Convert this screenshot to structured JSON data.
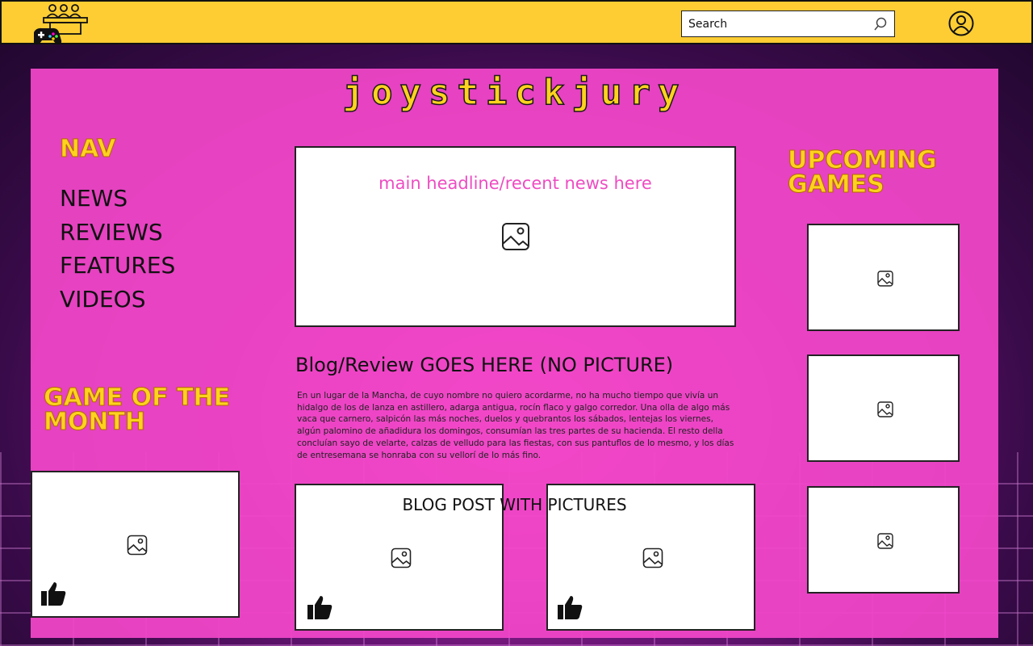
{
  "site": {
    "title": "JoystickJury"
  },
  "header": {
    "search_placeholder": "Search",
    "icons": [
      "jury-gamepad-logo",
      "search-icon",
      "user-icon"
    ]
  },
  "nav": {
    "heading": "NAV",
    "items": [
      {
        "label": "NEWS"
      },
      {
        "label": "REVIEWS"
      },
      {
        "label": "FEATURES"
      },
      {
        "label": "VIDEOS"
      }
    ]
  },
  "main": {
    "headline_placeholder": "main headline/recent news here",
    "blog_title": "Blog/Review GOES HERE (NO PICTURE)",
    "blog_body": "En un lugar de la Mancha, de cuyo nombre no quiero acordarme, no ha mucho tiempo que vivía un hidalgo de los de lanza en astillero, adarga antigua, rocín flaco y galgo corredor. Una olla de algo más vaca que carnero, salpicón las más noches, duelos y quebrantos los sábados, lentejas los viernes, algún palomino de añadidura los domingos, consumían las tres partes de su hacienda. El resto della concluían sayo de velarte, calzas de velludo para las fiestas, con sus pantuflos de lo mesmo, y los días de entresemana se honraba con su vellorí de lo más fino.",
    "posts_label": "BLOG POST WITH PICTURES"
  },
  "game_of_the_month": {
    "heading": "GAME OF THE MONTH"
  },
  "upcoming": {
    "heading": "UPCOMING GAMES"
  },
  "colors": {
    "topbar": "#fecd33",
    "panel": "#f046c8",
    "title_yellow": "#ffd21f",
    "headline_pink": "#ee4cc2"
  }
}
